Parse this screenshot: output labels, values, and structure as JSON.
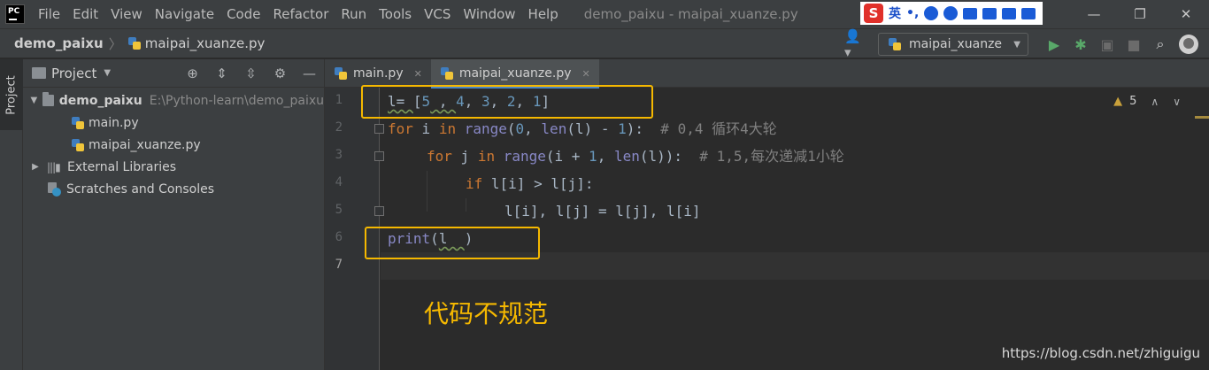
{
  "menu": {
    "app_logo": "PC",
    "items": [
      "File",
      "Edit",
      "View",
      "Navigate",
      "Code",
      "Refactor",
      "Run",
      "Tools",
      "VCS",
      "Window",
      "Help"
    ],
    "window_title": "demo_paixu - maipai_xuanze.py"
  },
  "ime": {
    "logo": "S",
    "lang": "英",
    "punct": "•,"
  },
  "window_controls": {
    "minimize": "—",
    "restore": "❐",
    "close": "✕"
  },
  "breadcrumb": {
    "project": "demo_paixu",
    "file": "maipai_xuanze.py"
  },
  "toolbar": {
    "run_config": "maipai_xuanze"
  },
  "tool_window": {
    "project_tab": "Project"
  },
  "project_panel": {
    "title": "Project",
    "root_name": "demo_paixu",
    "root_path": "E:\\Python-learn\\demo_paixu",
    "files": [
      "main.py",
      "maipai_xuanze.py"
    ],
    "external_libraries": "External Libraries",
    "scratches": "Scratches and Consoles"
  },
  "editor": {
    "tabs": [
      {
        "label": "main.py",
        "active": false
      },
      {
        "label": "maipai_xuanze.py",
        "active": true
      }
    ],
    "line_numbers": [
      "1",
      "2",
      "3",
      "4",
      "5",
      "6",
      "7"
    ],
    "warning_count": "5",
    "code": {
      "l1_var": "l= ",
      "l1_open": "[",
      "l1_n1": "5",
      "l1_sep1": " , ",
      "l1_n2": "4",
      "l1_n3": "3",
      "l1_n4": "2",
      "l1_n5": "1",
      "l1_close": "]",
      "l2_for": "for",
      "l2_i": " i ",
      "l2_in": "in",
      "l2_range": " range",
      "l2_open": "(",
      "l2_zero": "0",
      "l2_comma": ", ",
      "l2_len": "len",
      "l2_mid": "(l) - ",
      "l2_one": "1",
      "l2_end": "):  ",
      "l2_comment": "# 0,4 循环4大轮",
      "l3_for": "for",
      "l3_j": " j ",
      "l3_in": "in",
      "l3_range": " range",
      "l3_mid": "(i + ",
      "l3_one": "1",
      "l3_comma": ", ",
      "l3_len": "len",
      "l3_end": "(l)):  ",
      "l3_comment": "# 1,5,每次递减1小轮",
      "l4_if": "if",
      "l4_rest": " l[i] > l[j]:",
      "l5_text": "l[i], l[j] = l[j], l[i]",
      "l6_print": "print",
      "l6_open": "(",
      "l6_arg": "l  ",
      "l6_close": ")"
    },
    "annotation": "代码不规范"
  },
  "watermark": "https://blog.csdn.net/zhiguigu",
  "colors": {
    "highlight_box": "#f5b800",
    "keyword": "#cc7832",
    "number": "#6897bb",
    "builtin": "#8888c6",
    "comment": "#808080"
  }
}
